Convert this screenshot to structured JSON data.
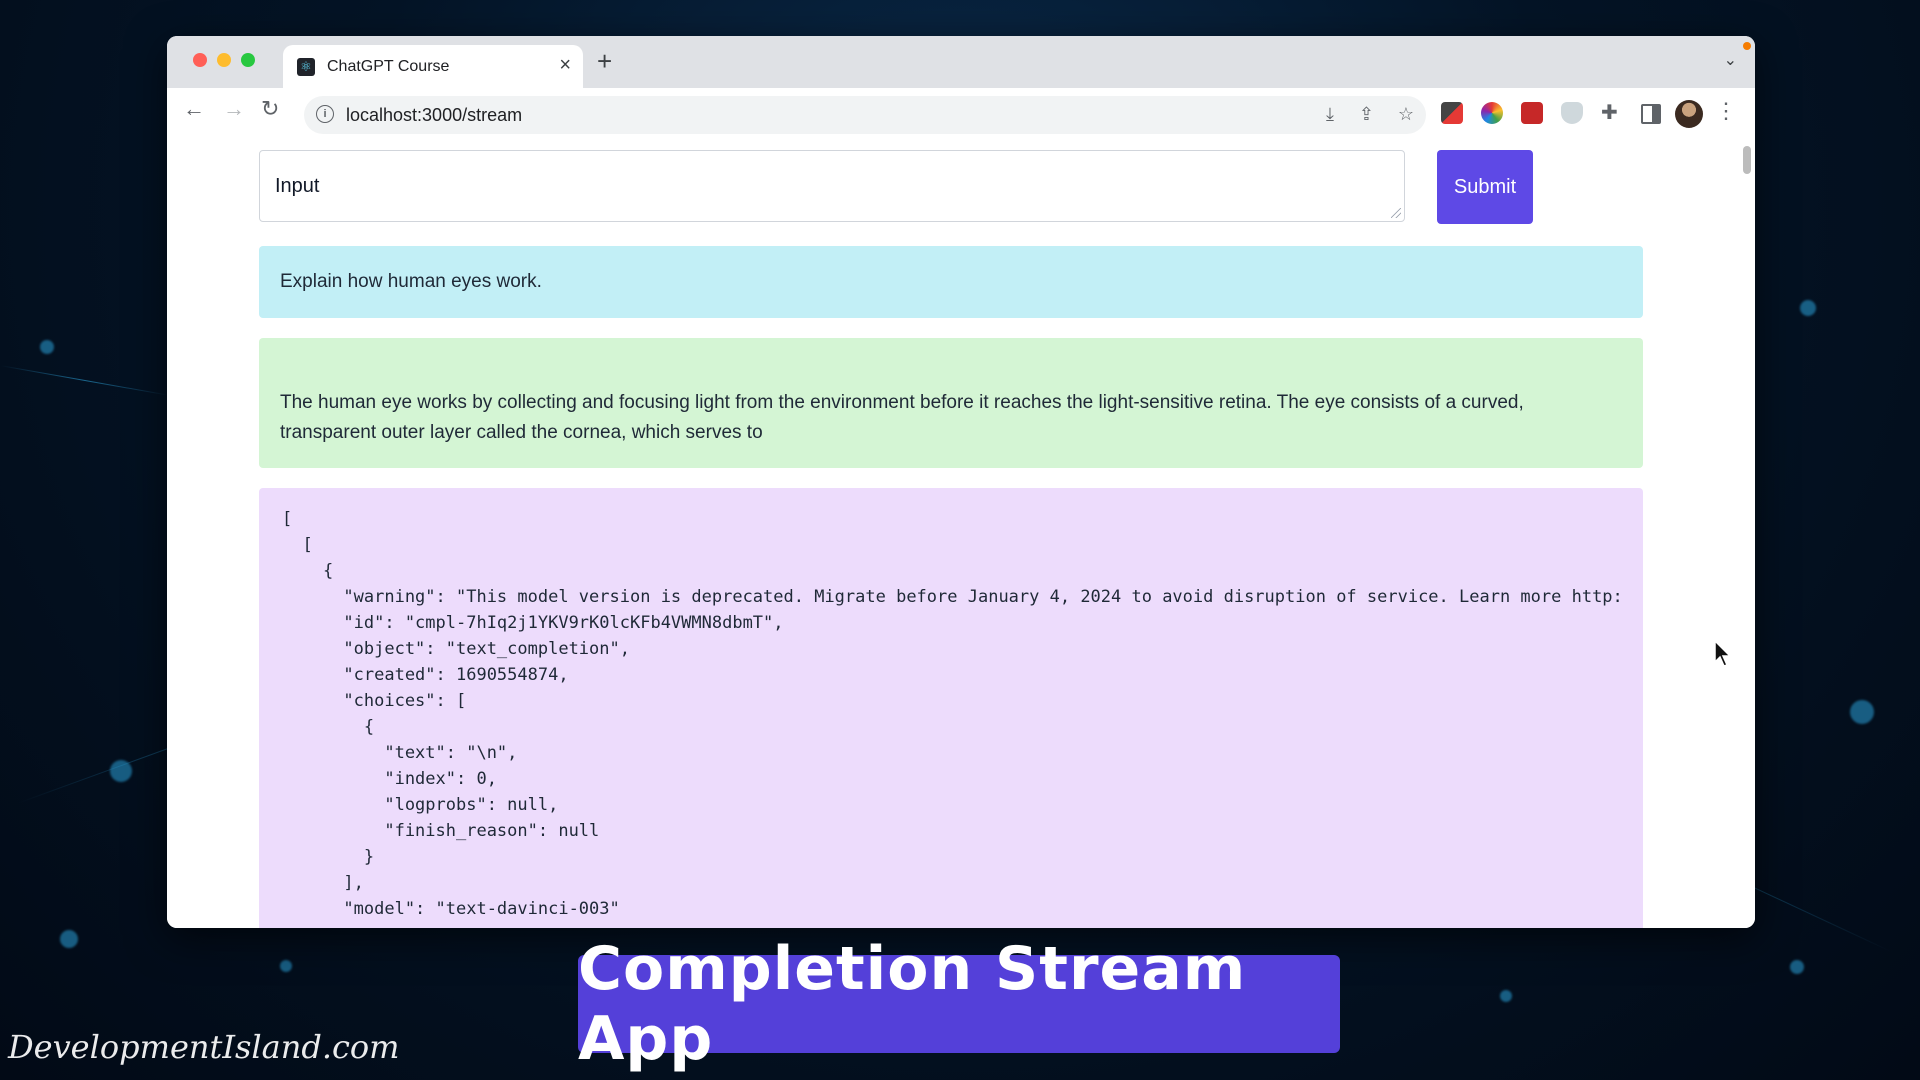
{
  "browser": {
    "tab_title": "ChatGPT Course",
    "url": "localhost:3000/stream",
    "close_glyph": "×",
    "new_tab_glyph": "+"
  },
  "form": {
    "input_value": "Input",
    "submit_label": "Submit"
  },
  "prompt": {
    "text": "Explain how human eyes work."
  },
  "response": {
    "text": "The human eye works by collecting and focusing light from the environment before it reaches the light-sensitive retina. The eye consists of a curved, transparent outer layer called the cornea, which serves to"
  },
  "json_dump": {
    "text": "[\n  [\n    {\n      \"warning\": \"This model version is deprecated. Migrate before January 4, 2024 to avoid disruption of service. Learn more http:\n      \"id\": \"cmpl-7hIq2j1YKV9rK0lcKFb4VWMN8dbmT\",\n      \"object\": \"text_completion\",\n      \"created\": 1690554874,\n      \"choices\": [\n        {\n          \"text\": \"\\n\",\n          \"index\": 0,\n          \"logprobs\": null,\n          \"finish_reason\": null\n        }\n      ],\n      \"model\": \"text-davinci-003\""
  },
  "overlay": {
    "banner_title": "Completion Stream App",
    "watermark": "DevelopmentIsland.com"
  },
  "colors": {
    "submit_bg": "#5e49e6",
    "prompt_bg": "#c2eff6",
    "response_bg": "#d4f5d4",
    "json_bg": "#eddcfc",
    "banner_bg": "#5440d9"
  }
}
